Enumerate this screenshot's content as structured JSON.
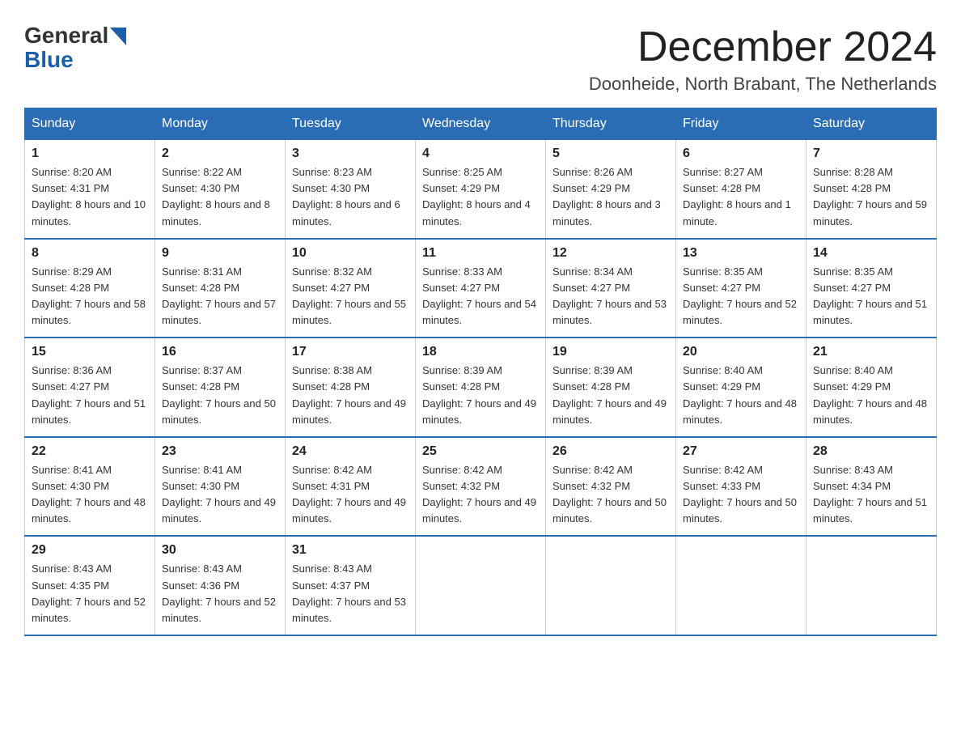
{
  "logo": {
    "general": "General",
    "blue": "Blue",
    "arrow": "▶"
  },
  "title": "December 2024",
  "location": "Doonheide, North Brabant, The Netherlands",
  "days_header": [
    "Sunday",
    "Monday",
    "Tuesday",
    "Wednesday",
    "Thursday",
    "Friday",
    "Saturday"
  ],
  "weeks": [
    [
      {
        "day": "1",
        "sunrise": "8:20 AM",
        "sunset": "4:31 PM",
        "daylight": "8 hours and 10 minutes."
      },
      {
        "day": "2",
        "sunrise": "8:22 AM",
        "sunset": "4:30 PM",
        "daylight": "8 hours and 8 minutes."
      },
      {
        "day": "3",
        "sunrise": "8:23 AM",
        "sunset": "4:30 PM",
        "daylight": "8 hours and 6 minutes."
      },
      {
        "day": "4",
        "sunrise": "8:25 AM",
        "sunset": "4:29 PM",
        "daylight": "8 hours and 4 minutes."
      },
      {
        "day": "5",
        "sunrise": "8:26 AM",
        "sunset": "4:29 PM",
        "daylight": "8 hours and 3 minutes."
      },
      {
        "day": "6",
        "sunrise": "8:27 AM",
        "sunset": "4:28 PM",
        "daylight": "8 hours and 1 minute."
      },
      {
        "day": "7",
        "sunrise": "8:28 AM",
        "sunset": "4:28 PM",
        "daylight": "7 hours and 59 minutes."
      }
    ],
    [
      {
        "day": "8",
        "sunrise": "8:29 AM",
        "sunset": "4:28 PM",
        "daylight": "7 hours and 58 minutes."
      },
      {
        "day": "9",
        "sunrise": "8:31 AM",
        "sunset": "4:28 PM",
        "daylight": "7 hours and 57 minutes."
      },
      {
        "day": "10",
        "sunrise": "8:32 AM",
        "sunset": "4:27 PM",
        "daylight": "7 hours and 55 minutes."
      },
      {
        "day": "11",
        "sunrise": "8:33 AM",
        "sunset": "4:27 PM",
        "daylight": "7 hours and 54 minutes."
      },
      {
        "day": "12",
        "sunrise": "8:34 AM",
        "sunset": "4:27 PM",
        "daylight": "7 hours and 53 minutes."
      },
      {
        "day": "13",
        "sunrise": "8:35 AM",
        "sunset": "4:27 PM",
        "daylight": "7 hours and 52 minutes."
      },
      {
        "day": "14",
        "sunrise": "8:35 AM",
        "sunset": "4:27 PM",
        "daylight": "7 hours and 51 minutes."
      }
    ],
    [
      {
        "day": "15",
        "sunrise": "8:36 AM",
        "sunset": "4:27 PM",
        "daylight": "7 hours and 51 minutes."
      },
      {
        "day": "16",
        "sunrise": "8:37 AM",
        "sunset": "4:28 PM",
        "daylight": "7 hours and 50 minutes."
      },
      {
        "day": "17",
        "sunrise": "8:38 AM",
        "sunset": "4:28 PM",
        "daylight": "7 hours and 49 minutes."
      },
      {
        "day": "18",
        "sunrise": "8:39 AM",
        "sunset": "4:28 PM",
        "daylight": "7 hours and 49 minutes."
      },
      {
        "day": "19",
        "sunrise": "8:39 AM",
        "sunset": "4:28 PM",
        "daylight": "7 hours and 49 minutes."
      },
      {
        "day": "20",
        "sunrise": "8:40 AM",
        "sunset": "4:29 PM",
        "daylight": "7 hours and 48 minutes."
      },
      {
        "day": "21",
        "sunrise": "8:40 AM",
        "sunset": "4:29 PM",
        "daylight": "7 hours and 48 minutes."
      }
    ],
    [
      {
        "day": "22",
        "sunrise": "8:41 AM",
        "sunset": "4:30 PM",
        "daylight": "7 hours and 48 minutes."
      },
      {
        "day": "23",
        "sunrise": "8:41 AM",
        "sunset": "4:30 PM",
        "daylight": "7 hours and 49 minutes."
      },
      {
        "day": "24",
        "sunrise": "8:42 AM",
        "sunset": "4:31 PM",
        "daylight": "7 hours and 49 minutes."
      },
      {
        "day": "25",
        "sunrise": "8:42 AM",
        "sunset": "4:32 PM",
        "daylight": "7 hours and 49 minutes."
      },
      {
        "day": "26",
        "sunrise": "8:42 AM",
        "sunset": "4:32 PM",
        "daylight": "7 hours and 50 minutes."
      },
      {
        "day": "27",
        "sunrise": "8:42 AM",
        "sunset": "4:33 PM",
        "daylight": "7 hours and 50 minutes."
      },
      {
        "day": "28",
        "sunrise": "8:43 AM",
        "sunset": "4:34 PM",
        "daylight": "7 hours and 51 minutes."
      }
    ],
    [
      {
        "day": "29",
        "sunrise": "8:43 AM",
        "sunset": "4:35 PM",
        "daylight": "7 hours and 52 minutes."
      },
      {
        "day": "30",
        "sunrise": "8:43 AM",
        "sunset": "4:36 PM",
        "daylight": "7 hours and 52 minutes."
      },
      {
        "day": "31",
        "sunrise": "8:43 AM",
        "sunset": "4:37 PM",
        "daylight": "7 hours and 53 minutes."
      },
      null,
      null,
      null,
      null
    ]
  ]
}
